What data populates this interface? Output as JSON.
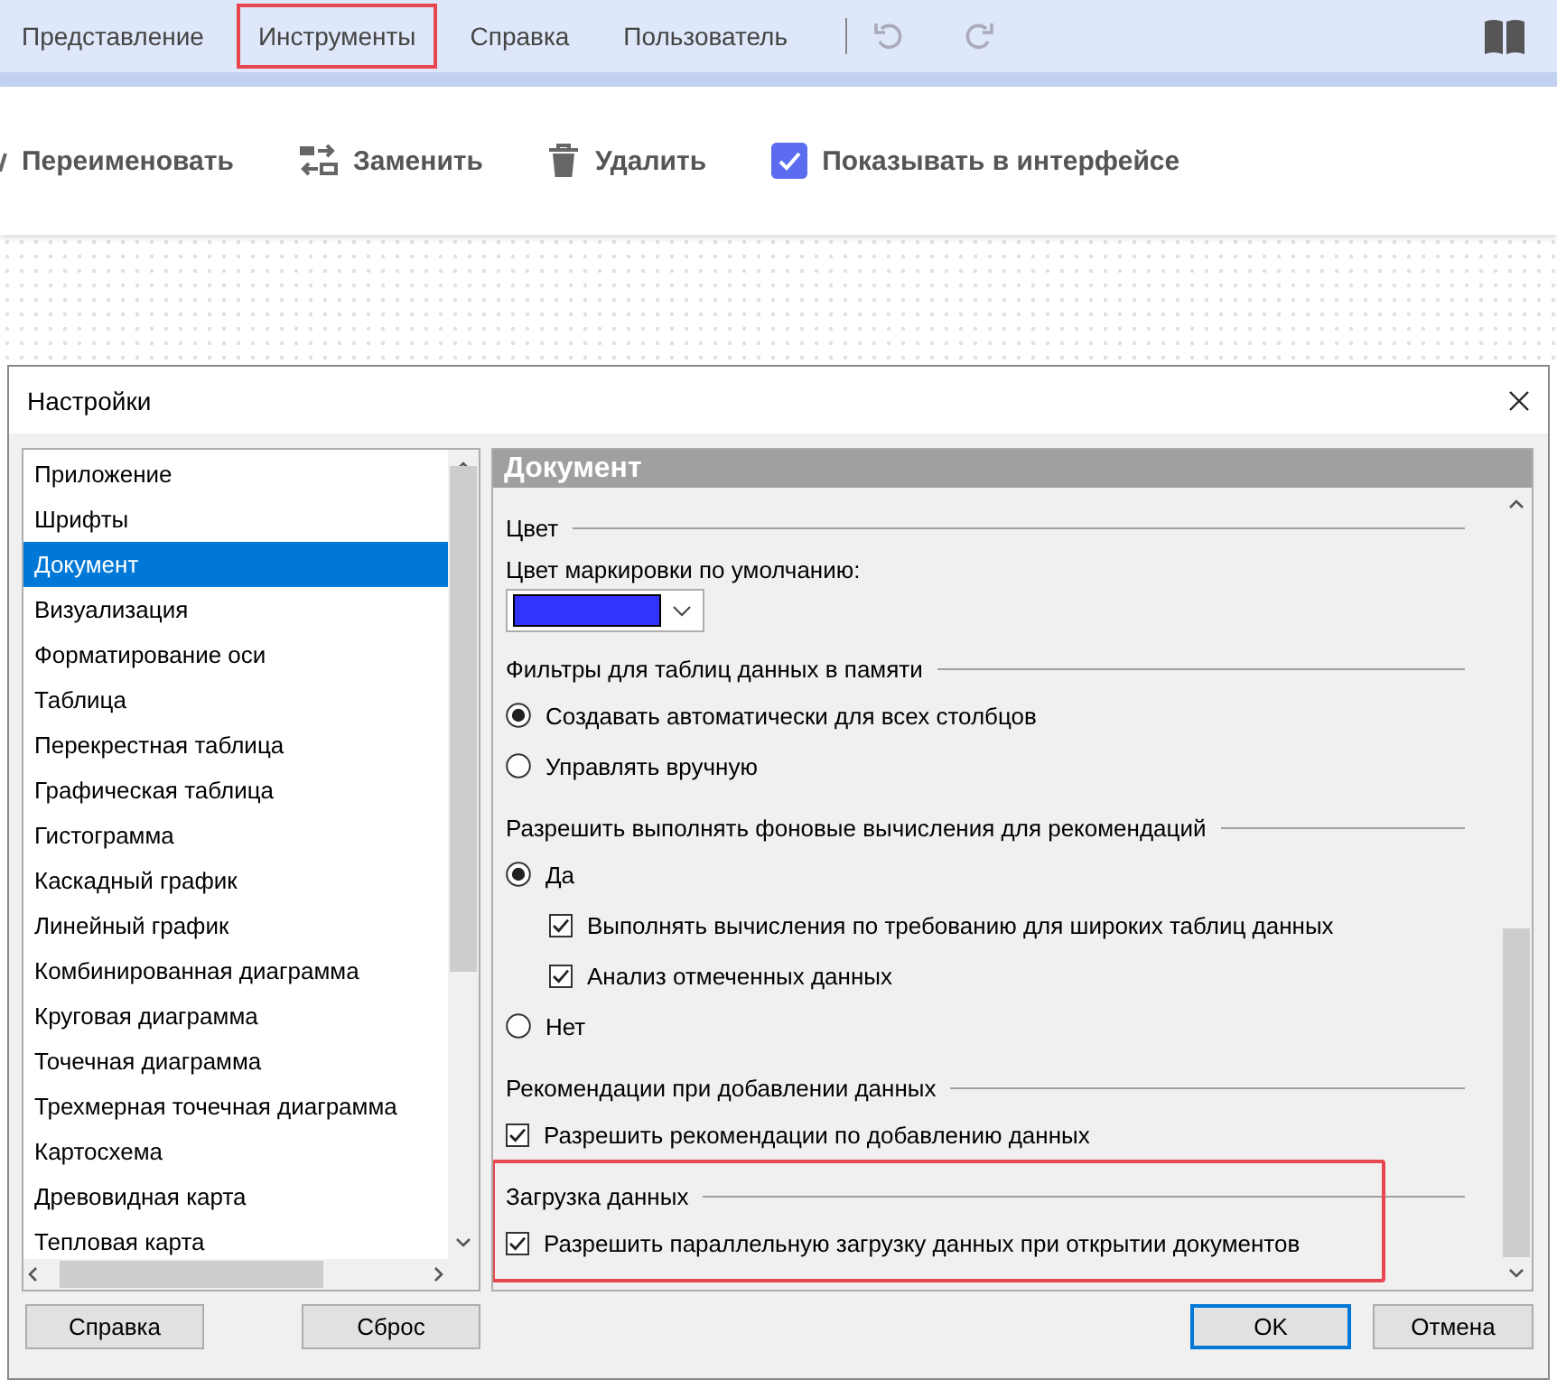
{
  "menu": [
    {
      "label": "Представление",
      "highlighted": false
    },
    {
      "label": "Инструменты",
      "highlighted": true
    },
    {
      "label": "Справка",
      "highlighted": false
    },
    {
      "label": "Пользователь",
      "highlighted": false
    }
  ],
  "toolbar": [
    {
      "kind": "rename",
      "label": "Переименовать"
    },
    {
      "kind": "replace",
      "label": "Заменить"
    },
    {
      "kind": "delete",
      "label": "Удалить"
    },
    {
      "kind": "checkbox",
      "label": "Показывать в интерфейсе",
      "checked": true
    }
  ],
  "dialog": {
    "title": "Настройки",
    "categories": [
      {
        "label": "Приложение",
        "selected": false
      },
      {
        "label": "Шрифты",
        "selected": false
      },
      {
        "label": "Документ",
        "selected": true
      },
      {
        "label": "Визуализация",
        "selected": false
      },
      {
        "label": "Форматирование оси",
        "selected": false
      },
      {
        "label": "Таблица",
        "selected": false
      },
      {
        "label": "Перекрестная таблица",
        "selected": false
      },
      {
        "label": "Графическая таблица",
        "selected": false
      },
      {
        "label": "Гистограмма",
        "selected": false
      },
      {
        "label": "Каскадный график",
        "selected": false
      },
      {
        "label": "Линейный график",
        "selected": false
      },
      {
        "label": "Комбинированная диаграмма",
        "selected": false
      },
      {
        "label": "Круговая диаграмма",
        "selected": false
      },
      {
        "label": "Точечная диаграмма",
        "selected": false
      },
      {
        "label": "Трехмерная точечная диаграмма",
        "selected": false
      },
      {
        "label": "Картосхема",
        "selected": false
      },
      {
        "label": "Древовидная карта",
        "selected": false
      },
      {
        "label": "Тепловая карта",
        "selected": false
      }
    ],
    "panel_title": "Документ",
    "sections": [
      {
        "title": "Цвет",
        "highlighted": false,
        "items": [
          {
            "kind": "label",
            "label": "Цвет маркировки по умолчанию:"
          },
          {
            "kind": "color",
            "color": "#3333ff"
          }
        ]
      },
      {
        "title": "Фильтры для таблиц данных в памяти",
        "highlighted": false,
        "items": [
          {
            "kind": "radio",
            "label": "Создавать автоматически для всех столбцов",
            "selected": true
          },
          {
            "kind": "radio",
            "label": "Управлять вручную",
            "selected": false
          }
        ]
      },
      {
        "title": "Разрешить выполнять фоновые вычисления для рекомендаций",
        "highlighted": false,
        "items": [
          {
            "kind": "radio",
            "label": "Да",
            "selected": true,
            "children": [
              {
                "kind": "checkbox",
                "label": "Выполнять вычисления по требованию для широких таблиц данных",
                "checked": true
              },
              {
                "kind": "checkbox",
                "label": "Анализ отмеченных данных",
                "checked": true
              }
            ]
          },
          {
            "kind": "radio",
            "label": "Нет",
            "selected": false
          }
        ]
      },
      {
        "title": "Рекомендации при добавлении данных",
        "highlighted": false,
        "items": [
          {
            "kind": "checkbox",
            "label": "Разрешить рекомендации по добавлению данных",
            "checked": true
          }
        ]
      },
      {
        "title": "Загрузка данных",
        "highlighted": true,
        "items": [
          {
            "kind": "checkbox",
            "label": "Разрешить параллельную загрузку данных при открытии документов",
            "checked": true
          }
        ]
      }
    ],
    "buttons_left": [
      {
        "label": "Справка",
        "default": false
      },
      {
        "label": "Сброс",
        "default": false
      }
    ],
    "buttons_right": [
      {
        "label": "OK",
        "default": true
      },
      {
        "label": "Отмена",
        "default": false
      }
    ]
  }
}
